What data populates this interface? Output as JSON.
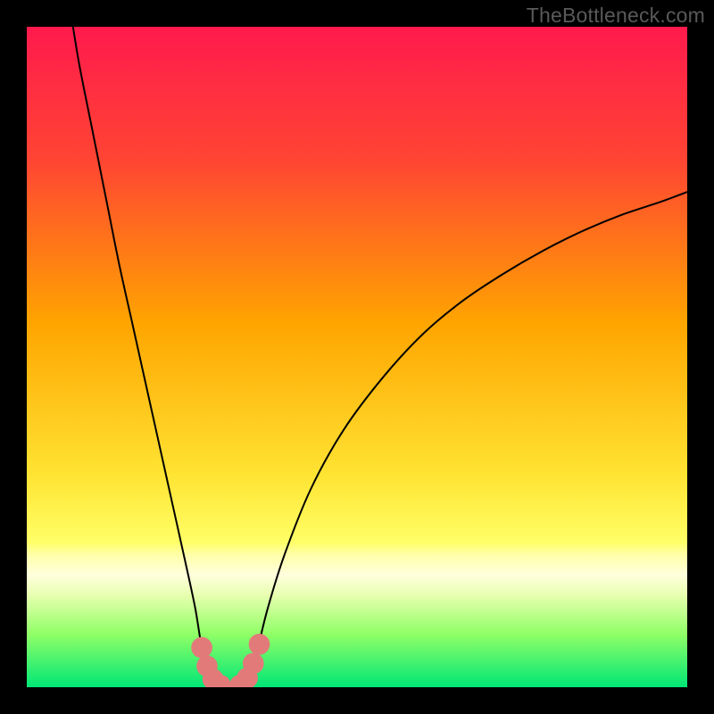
{
  "watermark": "TheBottleneck.com",
  "chart_data": {
    "type": "line",
    "title": "",
    "xlabel": "",
    "ylabel": "",
    "xlim": [
      0,
      100
    ],
    "ylim": [
      0,
      100
    ],
    "gradient_stops": [
      {
        "offset": 0,
        "color": "#ff1a4d"
      },
      {
        "offset": 20,
        "color": "#ff4433"
      },
      {
        "offset": 45,
        "color": "#ffa500"
      },
      {
        "offset": 68,
        "color": "#ffe433"
      },
      {
        "offset": 78,
        "color": "#ffff66"
      },
      {
        "offset": 80,
        "color": "#ffffaa"
      },
      {
        "offset": 83,
        "color": "#ffffdd"
      },
      {
        "offset": 86,
        "color": "#e8ffb0"
      },
      {
        "offset": 92,
        "color": "#8fff66"
      },
      {
        "offset": 100,
        "color": "#00e676"
      }
    ],
    "series": [
      {
        "name": "bottleneck-curve",
        "stroke": "#000000",
        "stroke_width": 2,
        "points": [
          {
            "x": 7.0,
            "y": 100.0
          },
          {
            "x": 8.0,
            "y": 94.0
          },
          {
            "x": 10.0,
            "y": 84.0
          },
          {
            "x": 12.0,
            "y": 74.0
          },
          {
            "x": 14.0,
            "y": 64.0
          },
          {
            "x": 16.0,
            "y": 55.0
          },
          {
            "x": 18.0,
            "y": 46.0
          },
          {
            "x": 20.0,
            "y": 37.0
          },
          {
            "x": 22.0,
            "y": 28.0
          },
          {
            "x": 24.0,
            "y": 19.0
          },
          {
            "x": 25.5,
            "y": 12.0
          },
          {
            "x": 26.5,
            "y": 6.0
          },
          {
            "x": 27.5,
            "y": 2.5
          },
          {
            "x": 28.5,
            "y": 0.5
          },
          {
            "x": 30.0,
            "y": 0.0
          },
          {
            "x": 31.5,
            "y": 0.0
          },
          {
            "x": 33.0,
            "y": 0.5
          },
          {
            "x": 34.0,
            "y": 2.5
          },
          {
            "x": 35.0,
            "y": 6.0
          },
          {
            "x": 36.5,
            "y": 12.0
          },
          {
            "x": 39.0,
            "y": 20.0
          },
          {
            "x": 43.0,
            "y": 30.0
          },
          {
            "x": 48.0,
            "y": 39.0
          },
          {
            "x": 54.0,
            "y": 47.0
          },
          {
            "x": 60.0,
            "y": 53.5
          },
          {
            "x": 66.0,
            "y": 58.5
          },
          {
            "x": 72.0,
            "y": 62.5
          },
          {
            "x": 78.0,
            "y": 66.0
          },
          {
            "x": 84.0,
            "y": 69.0
          },
          {
            "x": 90.0,
            "y": 71.5
          },
          {
            "x": 96.0,
            "y": 73.5
          },
          {
            "x": 100.0,
            "y": 75.0
          }
        ]
      }
    ],
    "markers": [
      {
        "x": 26.5,
        "y": 6.0,
        "r": 1.6,
        "color": "#e27a7a"
      },
      {
        "x": 27.3,
        "y": 3.2,
        "r": 1.6,
        "color": "#e27a7a"
      },
      {
        "x": 28.2,
        "y": 1.2,
        "r": 1.6,
        "color": "#e27a7a"
      },
      {
        "x": 29.3,
        "y": 0.3,
        "r": 1.6,
        "color": "#e27a7a"
      },
      {
        "x": 32.3,
        "y": 0.3,
        "r": 1.6,
        "color": "#e27a7a"
      },
      {
        "x": 33.4,
        "y": 1.4,
        "r": 1.6,
        "color": "#e27a7a"
      },
      {
        "x": 34.3,
        "y": 3.6,
        "r": 1.6,
        "color": "#e27a7a"
      },
      {
        "x": 35.2,
        "y": 6.5,
        "r": 1.6,
        "color": "#e27a7a"
      }
    ]
  }
}
